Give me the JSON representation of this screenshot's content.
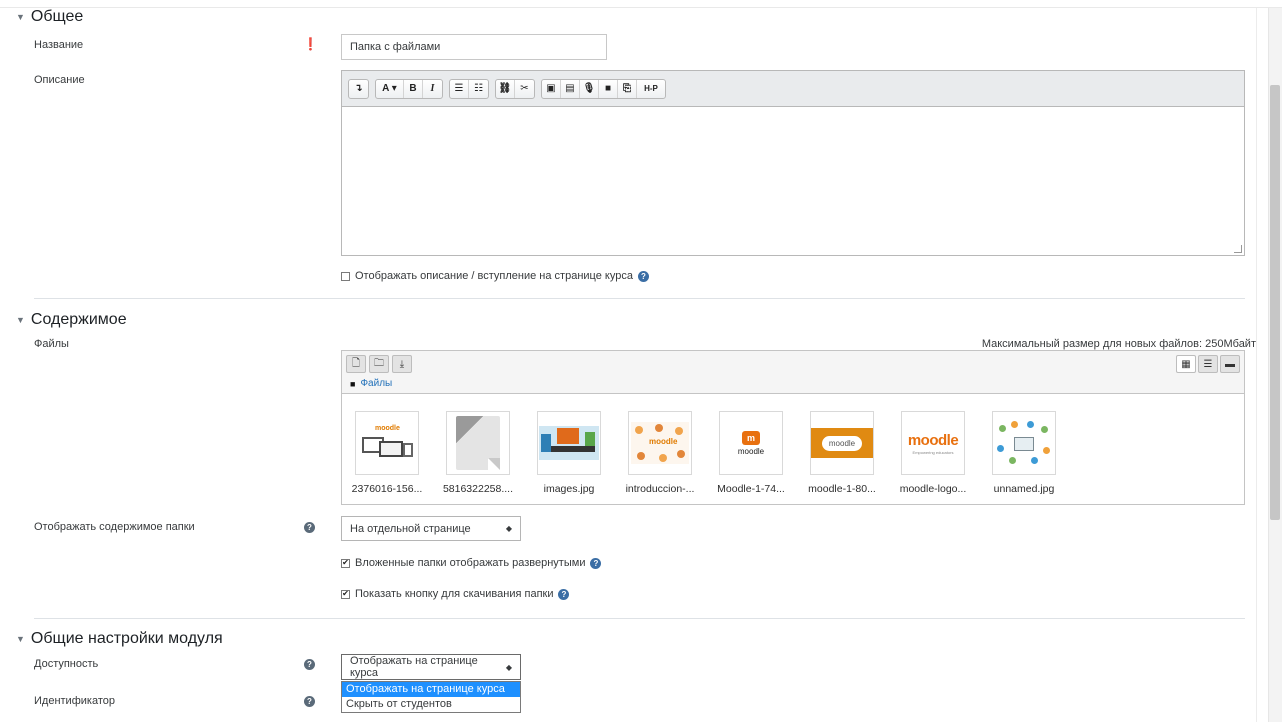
{
  "sections": {
    "general": "Общее",
    "content": "Содержимое",
    "module": "Общие настройки модуля"
  },
  "general": {
    "name_label": "Название",
    "name_value": "Папка с файлами",
    "desc_label": "Описание",
    "show_desc_label": "Отображать описание / вступление на странице курса"
  },
  "editor": {
    "toolbar": [
      "↴",
      "A ▾",
      "B",
      "I",
      "☰",
      "☷",
      "⛓",
      "✂",
      "▣",
      "▤",
      "🎙",
      "■",
      "⎘",
      "H-P"
    ]
  },
  "content": {
    "files_label": "Файлы",
    "max_size": "Максимальный размер для новых файлов: 250Мбайт",
    "breadcrumb": "Файлы",
    "files": [
      "2376016-156...",
      "5816322258....",
      "images.jpg",
      "introduccion-...",
      "Moodle-1-74...",
      "moodle-1-80...",
      "moodle-logo...",
      "unnamed.jpg"
    ],
    "display_label": "Отображать содержимое папки",
    "display_value": "На отдельной странице",
    "expand_label": "Вложенные папки отображать развернутыми",
    "download_label": "Показать кнопку для скачивания папки"
  },
  "module": {
    "availability_label": "Доступность",
    "availability_value": "Отображать на странице курса",
    "options": [
      "Отображать на странице курса",
      "Скрыть от студентов"
    ],
    "id_label": "Идентификатор"
  },
  "colors": {
    "accent": "#1f6fb8",
    "required": "#b52b27",
    "dropdown_selected": "#1e90ff"
  }
}
